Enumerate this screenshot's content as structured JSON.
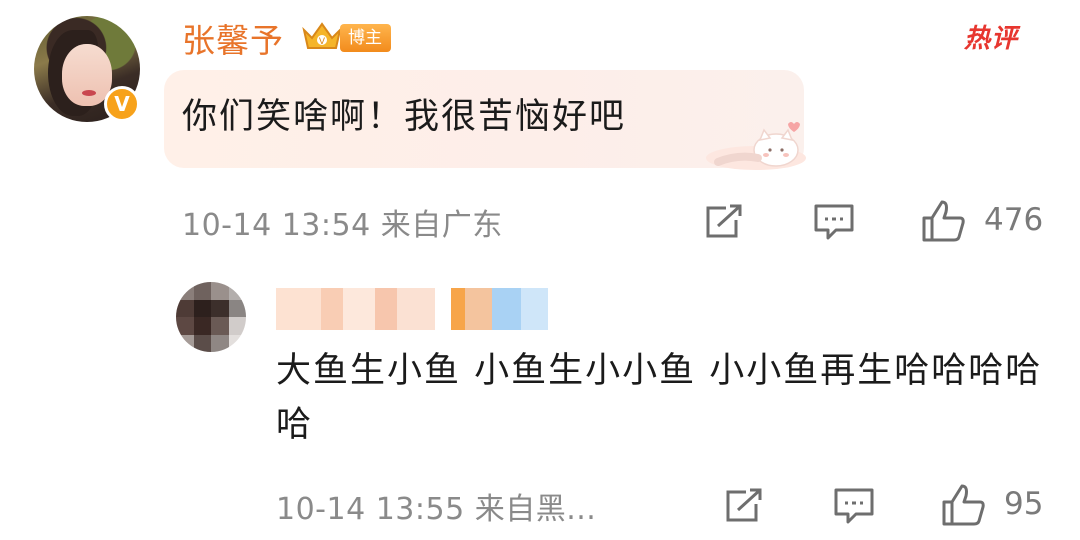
{
  "main_comment": {
    "username": "张馨予",
    "badge_label": "博主",
    "hot_label": "热评",
    "text": "你们笑啥啊！我很苦恼好吧",
    "meta": "10-14 13:54 来自广东",
    "likes": "476",
    "avatar_badge": "V"
  },
  "reply": {
    "text": "大鱼生小鱼 小鱼生小小鱼 小小鱼再生哈哈哈哈哈",
    "meta": "10-14 13:55 来自黑...",
    "likes": "95"
  },
  "icons": {
    "share": "share-icon",
    "comment": "comment-icon",
    "like": "like-icon",
    "crown": "crown-icon",
    "sticker": "cat-sticker"
  },
  "colors": {
    "username": "#e8742a",
    "hot": "#e7362f",
    "meta": "#8a8a8a",
    "badge": "#f28b1c"
  }
}
